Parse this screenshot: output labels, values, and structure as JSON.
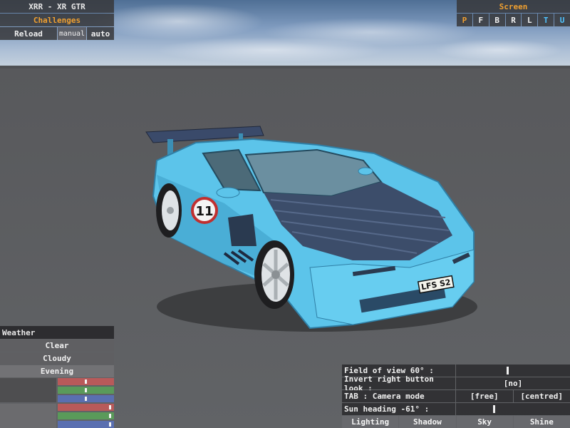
{
  "top_left": {
    "car_name": "XRR - XR GTR",
    "mode": "Challenges",
    "reload_label": "Reload",
    "manual_label": "manual",
    "auto_label": "auto"
  },
  "top_right": {
    "title": "Screen",
    "views": [
      "P",
      "F",
      "B",
      "R",
      "L",
      "T",
      "U"
    ],
    "active_view": "U"
  },
  "car": {
    "number": "11",
    "plate": "LFS S2",
    "body_color": "#5cc4ea"
  },
  "weather": {
    "header": "Weather",
    "options": [
      "Clear",
      "Cloudy",
      "Evening"
    ],
    "selected": "Evening",
    "sliders": [
      {
        "color": "#b85a5a",
        "level": 0.5
      },
      {
        "color": "#5a9a5a",
        "level": 0.5
      },
      {
        "color": "#5a6fb0",
        "level": 0.5
      },
      {
        "color": "#b85a5a",
        "level": 0.95
      },
      {
        "color": "#5a9a5a",
        "level": 0.95
      },
      {
        "color": "#5a6fb0",
        "level": 0.95
      }
    ]
  },
  "settings": {
    "fov_label": "Field of view 60° :",
    "fov_level": 0.45,
    "invert_label": "Invert right button look :",
    "invert_value": "[no]",
    "camera_label": "TAB : Camera mode",
    "camera_options": [
      "[free]",
      "[centred]"
    ],
    "sun_label": "Sun heading -61° :",
    "sun_level": 0.33,
    "tabs": [
      "Lighting",
      "Shadow",
      "Sky",
      "Shine"
    ]
  },
  "colors": {
    "accent_orange": "#f0a030",
    "accent_cyan": "#4fc3ff",
    "panel_bg": "#37373a"
  }
}
